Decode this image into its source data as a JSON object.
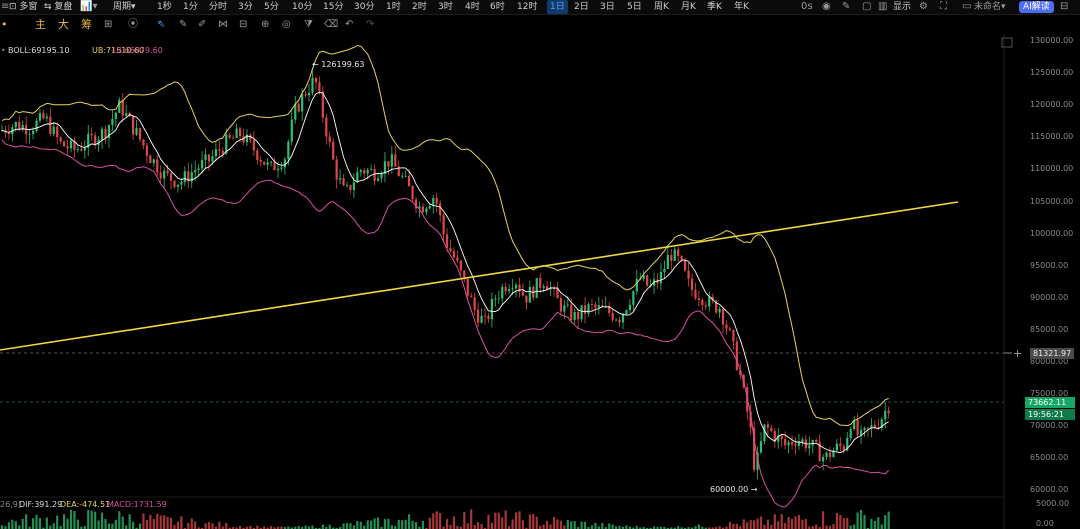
{
  "toolbar": {
    "left_icons_label": "≡",
    "duo_chuang": "多窗",
    "fu_pan": "复盘",
    "period_label": "周期",
    "intervals": [
      "1秒",
      "1分",
      "分时",
      "3分",
      "5分",
      "10分",
      "15分",
      "30分",
      "1时",
      "2时",
      "3时",
      "4时",
      "6时",
      "12时",
      "1日",
      "2日",
      "3日",
      "5日",
      "周K",
      "月K",
      "季K",
      "年K"
    ],
    "active_interval": "1日",
    "right": {
      "countdown": "0s",
      "display_label": "显示",
      "workspace_name": "未命名",
      "ai_button": "AI解读"
    }
  },
  "row2": {
    "zhu": "主",
    "da": "大",
    "chou": "筹"
  },
  "indicator": {
    "boll": "BOLL:69195.10",
    "ub": "UB:71510.60",
    "lb": "LB:66879.60",
    "macd_prefix": "26,9)",
    "dif": "DIF:391.29",
    "dea": "DEA:-474.51",
    "macd": "MACD:1731.59"
  },
  "annotations": {
    "high": "126199.63",
    "low": "60000.00"
  },
  "y_axis": {
    "ticks": [
      "130000.00",
      "125000.00",
      "120000.00",
      "115000.00",
      "110000.00",
      "105000.00",
      "100000.00",
      "95000.00",
      "90000.00",
      "85000.00",
      "80000.00",
      "75000.00",
      "70000.00",
      "65000.00",
      "60000.00"
    ],
    "macd_ticks": [
      "5000.00",
      "0.00"
    ]
  },
  "price_tags": {
    "crosshair": "81321.97",
    "last_price": "73662.11",
    "countdown": "19:56:21"
  },
  "colors": {
    "up": "#2fbf71",
    "down": "#e04848",
    "mid_band": "#d94fa5",
    "upper_band": "#e6d35a",
    "trendline": "#f0d840",
    "boll_line": "#ffffff"
  }
}
